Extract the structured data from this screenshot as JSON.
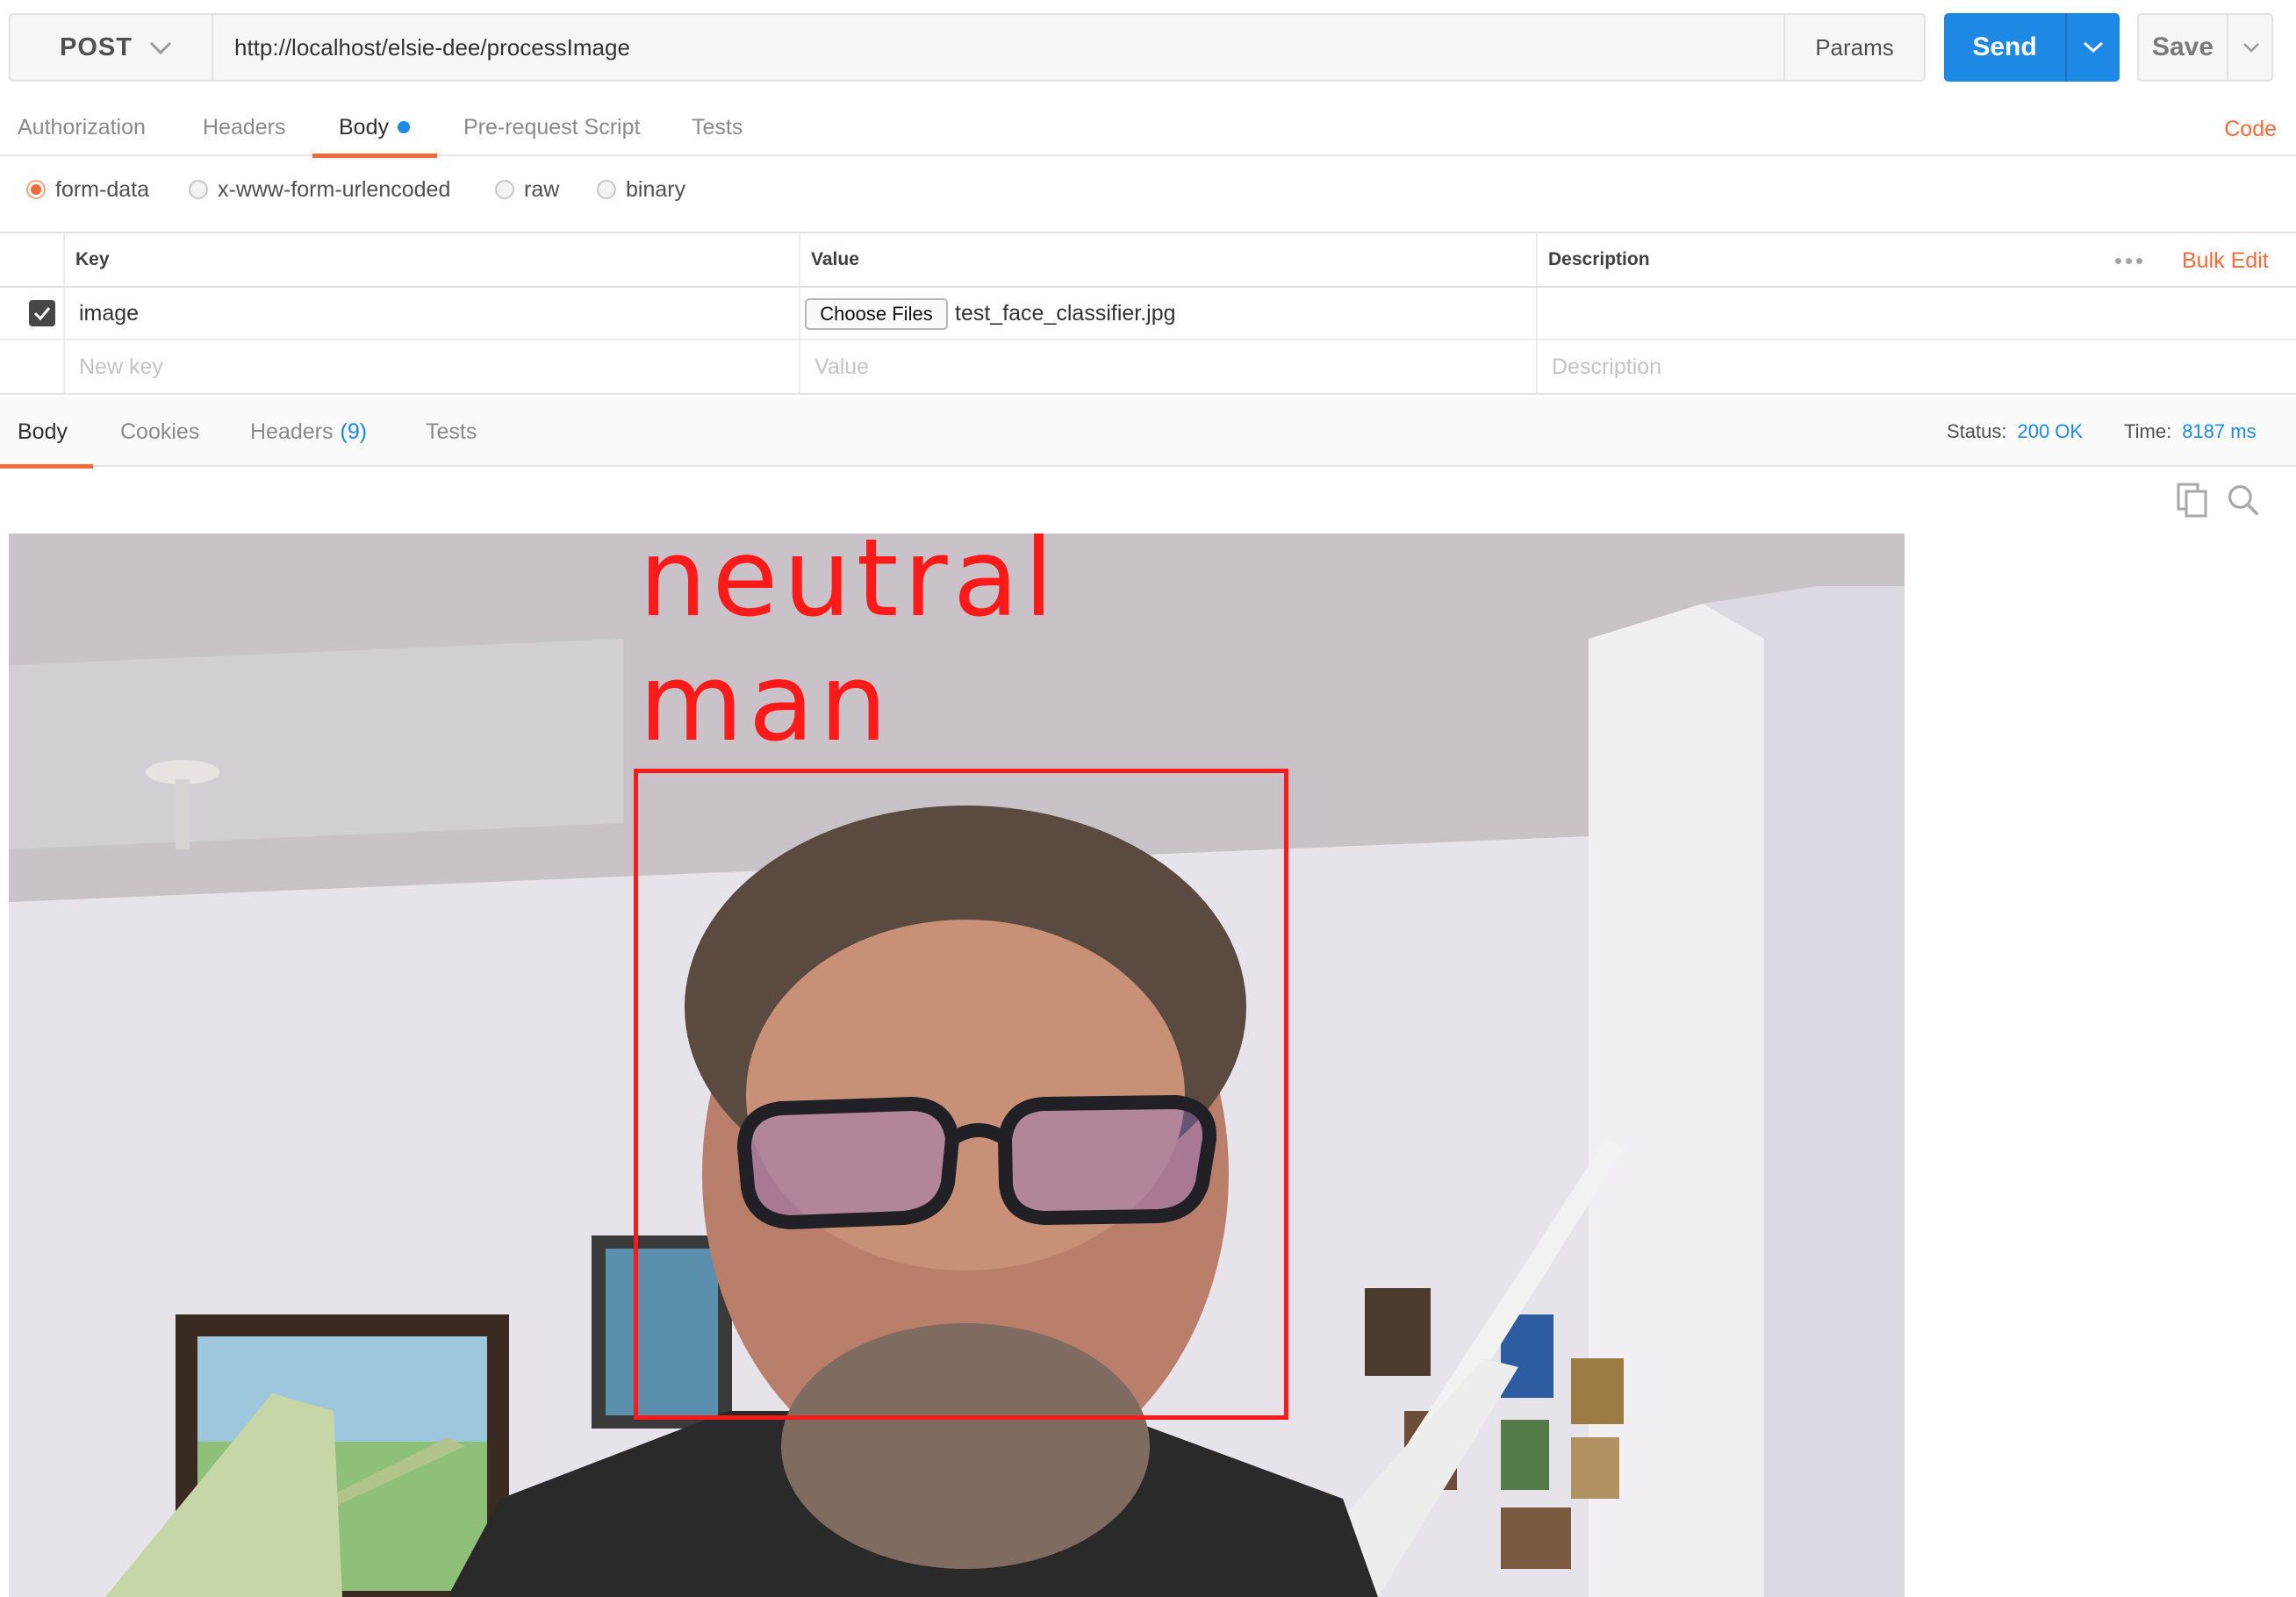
{
  "request": {
    "method": "POST",
    "url": "http://localhost/elsie-dee/processImage",
    "params_label": "Params",
    "send_label": "Send",
    "save_label": "Save"
  },
  "request_tabs": {
    "items": [
      "Authorization",
      "Headers",
      "Body",
      "Pre-request Script",
      "Tests"
    ],
    "active": "Body",
    "code_label": "Code"
  },
  "body_types": {
    "options": [
      "form-data",
      "x-www-form-urlencoded",
      "raw",
      "binary"
    ],
    "selected": "form-data"
  },
  "form_table": {
    "headers": {
      "key": "Key",
      "value": "Value",
      "description": "Description"
    },
    "bulk_edit_label": "Bulk Edit",
    "rows": [
      {
        "checked": true,
        "key": "image",
        "choose_label": "Choose Files",
        "file_name": "test_face_classifier.jpg",
        "description": ""
      }
    ],
    "new_row": {
      "key_placeholder": "New key",
      "value_placeholder": "Value",
      "description_placeholder": "Description"
    }
  },
  "response_tabs": {
    "body": "Body",
    "cookies": "Cookies",
    "headers": "Headers",
    "headers_count": "(9)",
    "tests": "Tests",
    "active": "Body"
  },
  "response_meta": {
    "status_label": "Status:",
    "status_value": "200 OK",
    "time_label": "Time:",
    "time_value": "8187 ms"
  },
  "response_image": {
    "labels": [
      "neutral",
      "man"
    ],
    "annotation_color": "#ff1a1a"
  },
  "icons": [
    "chevron-down-icon",
    "checkmark-icon",
    "copy-icon",
    "search-icon"
  ],
  "colors": {
    "accent": "#f26b3a",
    "primary": "#1e88e5"
  }
}
